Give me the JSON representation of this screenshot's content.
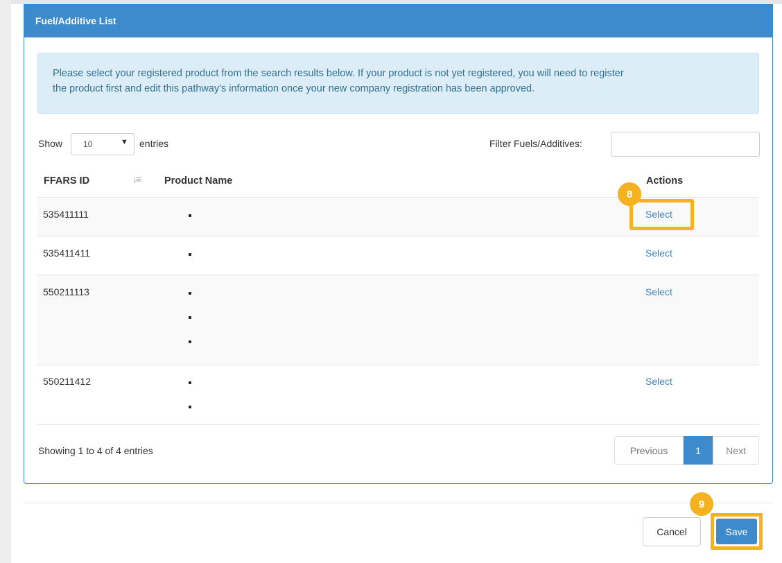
{
  "panel": {
    "title": "Fuel/Additive List"
  },
  "alert": {
    "line1": "Please select your registered product from the search results below. If your product is not yet registered, you will need to register",
    "line2": "the product first and edit this pathway's information once your new company registration has been approved."
  },
  "length_control": {
    "show_label": "Show",
    "selected_value": "10",
    "entries_label": "entries"
  },
  "filter": {
    "label": "Filter Fuels/Additives:",
    "value": ""
  },
  "table": {
    "columns": [
      "FFARS ID",
      "Product Name",
      "Actions"
    ],
    "rows": [
      {
        "id": "535411111",
        "action": "Select"
      },
      {
        "id": "535411411",
        "action": "Select"
      },
      {
        "id": "550211113",
        "action": "Select"
      },
      {
        "id": "550211412",
        "action": "Select"
      }
    ]
  },
  "info": {
    "text": "Showing 1 to 4 of 4 entries"
  },
  "pagination": {
    "previous": "Previous",
    "current": "1",
    "next": "Next"
  },
  "footer": {
    "cancel": "Cancel",
    "save": "Save"
  },
  "callouts": {
    "select_step": "8",
    "save_step": "9"
  },
  "colors": {
    "primary": "#3d8bcd",
    "highlight": "#f3b21e",
    "alert_bg": "#dcedf7",
    "link": "#3f86c3"
  }
}
